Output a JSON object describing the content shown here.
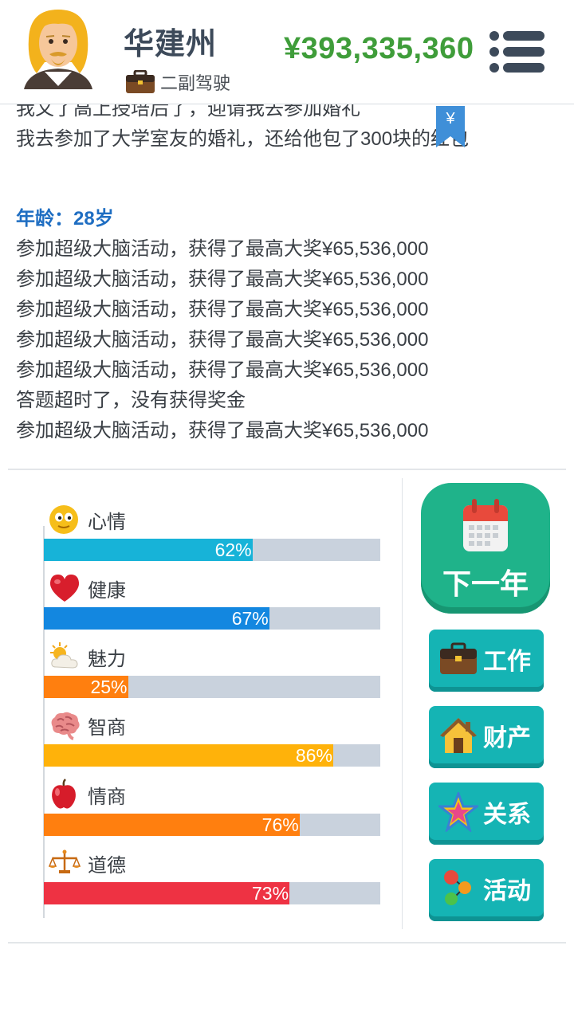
{
  "header": {
    "name": "华建州",
    "job": "二副驾驶",
    "money": "¥393,335,360",
    "avatar_icon": "blonde-man-avatar",
    "job_icon": "briefcase-icon",
    "menu_icon": "hamburger-menu-icon"
  },
  "log": {
    "lines": [
      {
        "text": "我又了高上授培后了，迎请我去参加婚礼",
        "style": "normal"
      },
      {
        "text": "我去参加了大学室友的婚礼，还给他包了300块的红包",
        "style": "normal"
      },
      {
        "text": "",
        "style": "spacer"
      },
      {
        "text": "年龄：28岁",
        "style": "age"
      },
      {
        "text": "参加超级大脑活动，获得了最高大奖¥65,536,000",
        "style": "normal"
      },
      {
        "text": "参加超级大脑活动，获得了最高大奖¥65,536,000",
        "style": "normal"
      },
      {
        "text": "参加超级大脑活动，获得了最高大奖¥65,536,000",
        "style": "normal"
      },
      {
        "text": "参加超级大脑活动，获得了最高大奖¥65,536,000",
        "style": "normal"
      },
      {
        "text": "参加超级大脑活动，获得了最高大奖¥65,536,000",
        "style": "normal"
      },
      {
        "text": "答题超时了，没有获得奖金",
        "style": "normal"
      },
      {
        "text": "参加超级大脑活动，获得了最高大奖¥65,536,000",
        "style": "normal"
      }
    ],
    "bookmark_symbol": "¥"
  },
  "stats": [
    {
      "key": "mood",
      "label": "心情",
      "value": 62,
      "text": "62%",
      "color": "#17b3d8",
      "icon": "smiley-face-icon"
    },
    {
      "key": "health",
      "label": "健康",
      "value": 67,
      "text": "67%",
      "color": "#1387e0",
      "icon": "heart-icon"
    },
    {
      "key": "charm",
      "label": "魅力",
      "value": 25,
      "text": "25%",
      "color": "#ff7f0f",
      "icon": "sun-cloud-icon"
    },
    {
      "key": "iq",
      "label": "智商",
      "value": 86,
      "text": "86%",
      "color": "#ffb20a",
      "icon": "brain-icon"
    },
    {
      "key": "eq",
      "label": "情商",
      "value": 76,
      "text": "76%",
      "color": "#ff7f0f",
      "icon": "apple-icon"
    },
    {
      "key": "morality",
      "label": "道德",
      "value": 73,
      "text": "73%",
      "color": "#ee3243",
      "icon": "balance-scale-icon"
    }
  ],
  "actions": {
    "next_year": {
      "label": "下一年",
      "icon": "calendar-icon"
    },
    "buttons": [
      {
        "key": "work",
        "label": "工作",
        "icon": "briefcase-icon"
      },
      {
        "key": "property",
        "label": "财产",
        "icon": "house-icon"
      },
      {
        "key": "relations",
        "label": "关系",
        "icon": "star-icon"
      },
      {
        "key": "activity",
        "label": "活动",
        "icon": "dots-icon"
      }
    ]
  }
}
